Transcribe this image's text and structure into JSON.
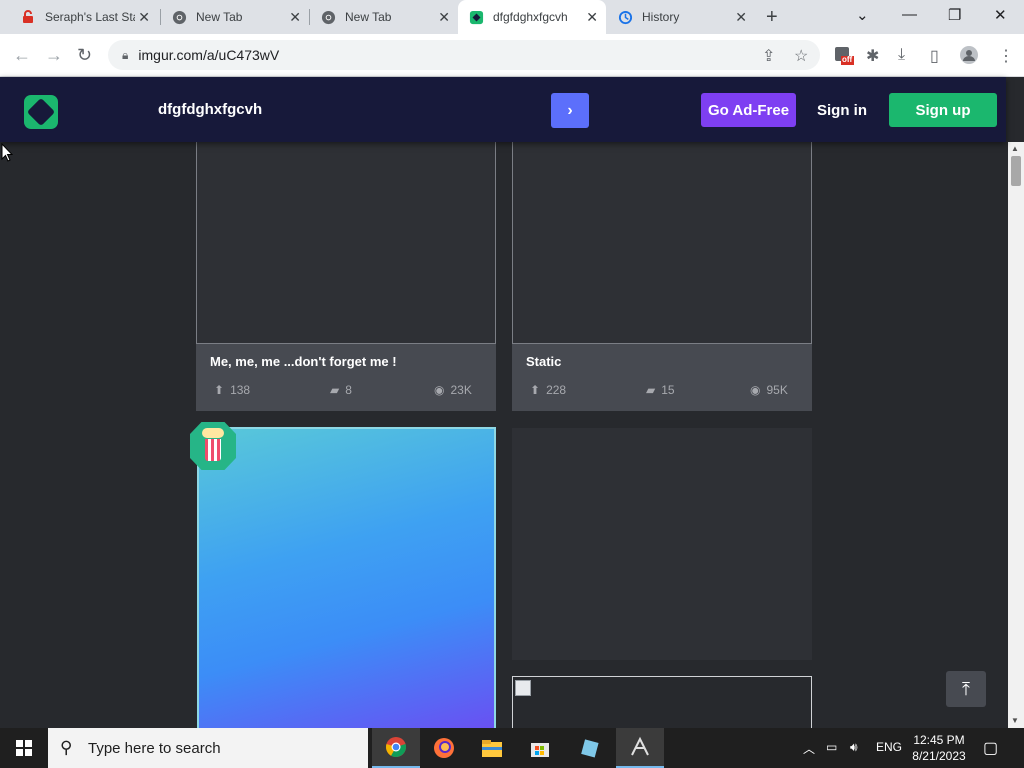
{
  "browser": {
    "tabs": [
      {
        "title": "Seraph's Last Sta",
        "icon": "red-lock-icon"
      },
      {
        "title": "New Tab",
        "icon": "chrome-icon"
      },
      {
        "title": "New Tab",
        "icon": "chrome-icon"
      },
      {
        "title": "dfgfdghxfgcvh",
        "icon": "imgur-icon",
        "active": true
      },
      {
        "title": "History",
        "icon": "history-icon"
      }
    ],
    "url": "imgur.com/a/uC473wV",
    "extension_badge": "off"
  },
  "header": {
    "post_title": "dfgfdghxfgcvh",
    "next_label": "›",
    "ad_free_label": "Go Ad-Free",
    "sign_in_label": "Sign in",
    "sign_up_label": "Sign up"
  },
  "posts": [
    {
      "title": "Me, me, me  ...don't forget me !",
      "upvotes": "138",
      "comments": "8",
      "views": "23K"
    },
    {
      "title": "Static",
      "upvotes": "228",
      "comments": "15",
      "views": "95K"
    }
  ],
  "taskbar": {
    "search_placeholder": "Type here to search",
    "language": "ENG",
    "time": "12:45 PM",
    "date": "8/21/2023"
  },
  "colors": {
    "imgur_header": "#17193a",
    "signup_green": "#1bb76e",
    "adfree_purple": "#7e3ff2",
    "next_blue": "#5c6ffb",
    "page_bg": "#27292d"
  }
}
